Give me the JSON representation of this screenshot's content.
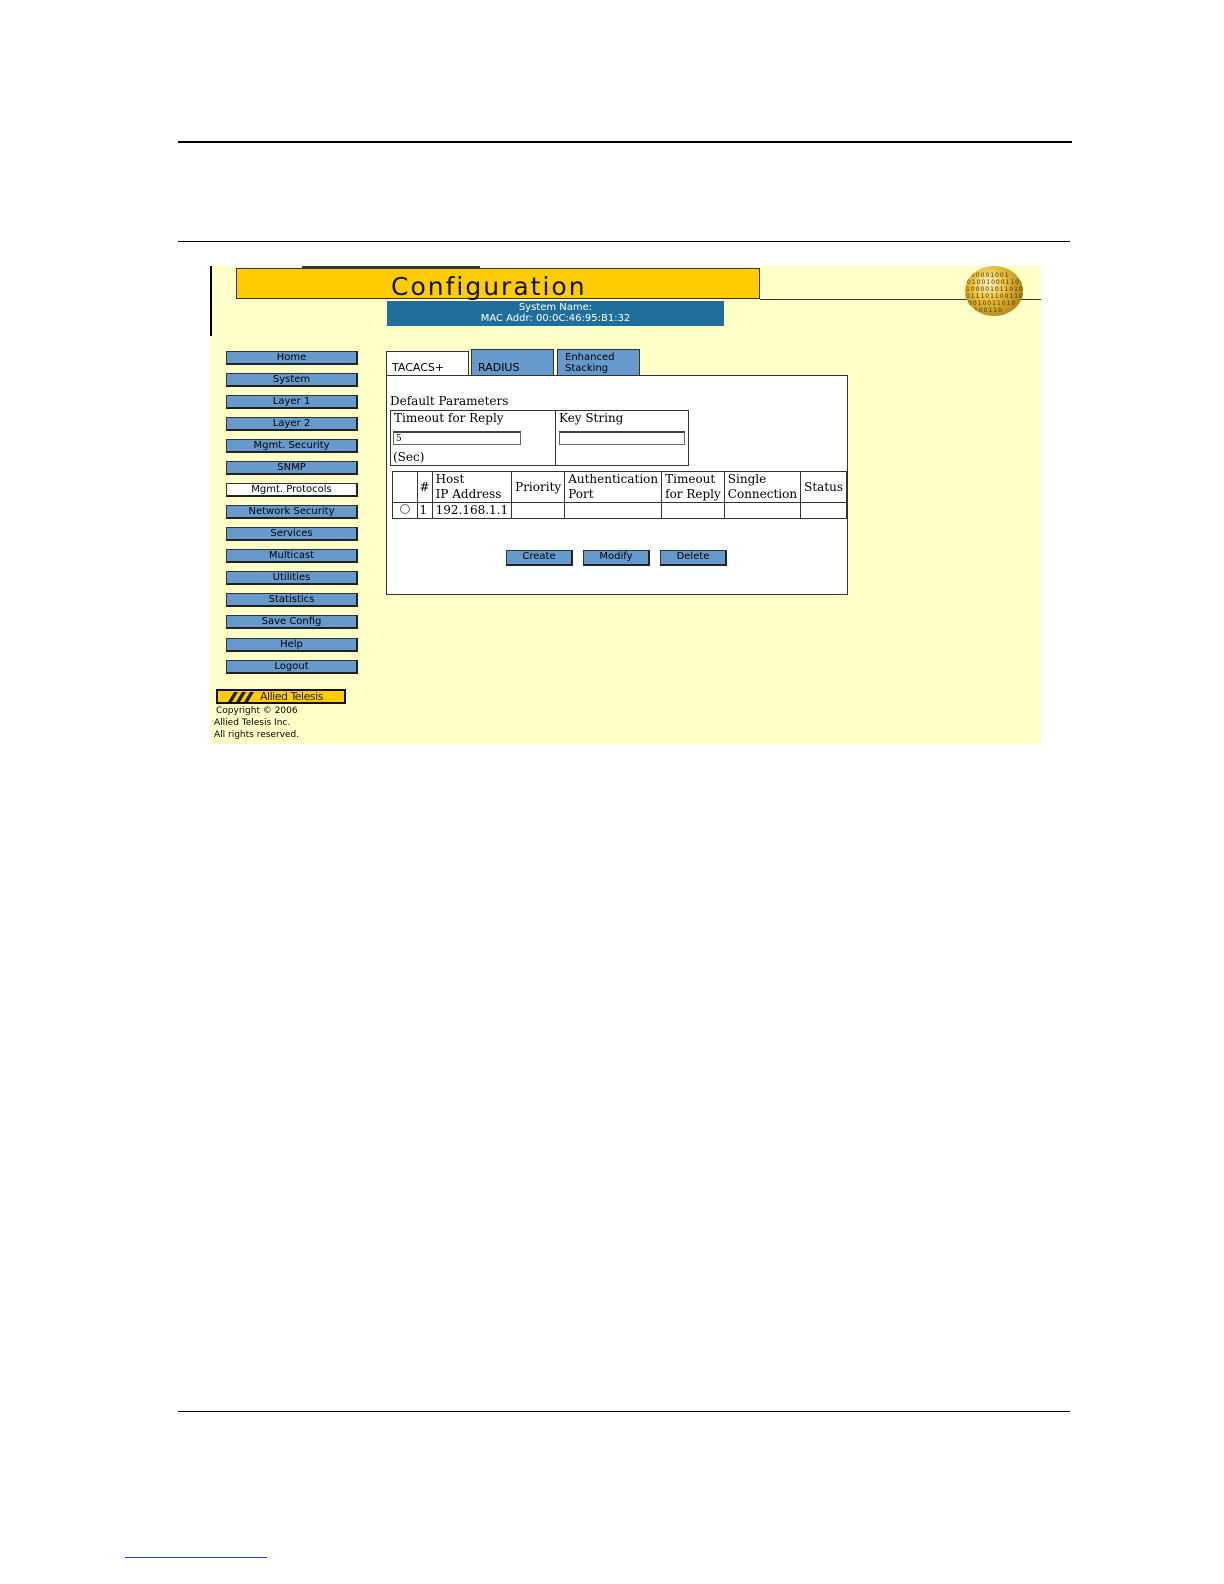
{
  "app": {
    "title": "Configuration",
    "system_name_label": "System Name:",
    "mac_addr_text": "MAC Addr: 00:0C:46:95:B1:32"
  },
  "sidebar": {
    "items": [
      {
        "label": "Home"
      },
      {
        "label": "System"
      },
      {
        "label": "Layer 1"
      },
      {
        "label": "Layer 2"
      },
      {
        "label": "Mgmt. Security"
      },
      {
        "label": "SNMP"
      },
      {
        "label": "Mgmt. Protocols"
      },
      {
        "label": "Network Security"
      },
      {
        "label": "Services"
      },
      {
        "label": "Multicast"
      },
      {
        "label": "Utilities"
      },
      {
        "label": "Statistics"
      },
      {
        "label": "Save Config"
      },
      {
        "label": "Help"
      },
      {
        "label": "Logout"
      }
    ],
    "active_index": 6
  },
  "branding": {
    "logo_text": "Allied Telesis",
    "copyright_lines": [
      "Copyright © 2006",
      "Allied Telesis Inc.",
      "All rights reserved."
    ]
  },
  "tabs": [
    {
      "label": "TACACS+",
      "active": true
    },
    {
      "label": "RADIUS",
      "active": false
    },
    {
      "label_line1": "Enhanced",
      "label_line2": "Stacking",
      "active": false
    }
  ],
  "default_params": {
    "title": "Default Parameters",
    "timeout_label": "Timeout for Reply",
    "timeout_value": "5",
    "timeout_unit": "(Sec)",
    "key_label": "Key String",
    "key_value": ""
  },
  "hosts_table": {
    "headers": {
      "num": "#",
      "host_l1": "Host",
      "host_l2": "IP Address",
      "priority": "Priority",
      "auth_l1": "Authentication",
      "auth_l2": "Port",
      "timeout_l1": "Timeout",
      "timeout_l2": "for Reply",
      "single_l1": "Single",
      "single_l2": "Connection",
      "status": "Status"
    },
    "rows": [
      {
        "num": "1",
        "host_ip": "192.168.1.1",
        "priority": "",
        "auth_port": "",
        "timeout": "",
        "single_connection": "",
        "status": ""
      }
    ]
  },
  "actions": {
    "create": "Create",
    "modify": "Modify",
    "delete": "Delete"
  },
  "colors": {
    "background": "#ffffc8",
    "title_bar": "#ffcc00",
    "header_box": "#1f6e9c",
    "button": "#6699cc"
  },
  "icons": {
    "globe": "globe-icon",
    "logo": "allied-telesis-logo"
  }
}
